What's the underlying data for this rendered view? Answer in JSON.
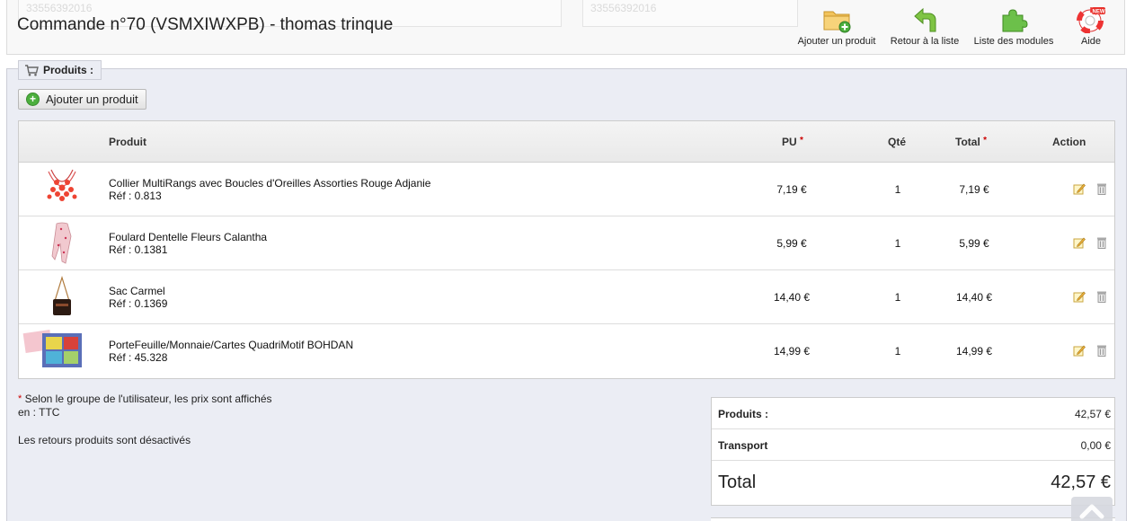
{
  "header": {
    "ghost_field_a": "33556392016",
    "ghost_field_b": "33556392016",
    "title": "Commande n°70 (VSMXIWXPB) - thomas trinque",
    "toolbar": {
      "add_product": "Ajouter un produit",
      "back_to_list": "Retour à la liste",
      "modules_list": "Liste des modules",
      "help": "Aide",
      "help_badge": "NEW"
    }
  },
  "panel": {
    "legend": "Produits :",
    "add_button": "Ajouter un produit"
  },
  "table": {
    "headers": {
      "product": "Produit",
      "unit_price": "PU",
      "unit_price_mark": "*",
      "qty": "Qté",
      "total": "Total",
      "total_mark": "*",
      "action": "Action"
    },
    "rows": [
      {
        "name": "Collier MultiRangs avec Boucles d'Oreilles Assorties Rouge Adjanie",
        "ref": "Réf : 0.813",
        "pu": "7,19 €",
        "qty": "1",
        "total": "7,19 €"
      },
      {
        "name": "Foulard Dentelle Fleurs Calantha",
        "ref": "Réf : 0.1381",
        "pu": "5,99 €",
        "qty": "1",
        "total": "5,99 €"
      },
      {
        "name": "Sac Carmel",
        "ref": "Réf : 0.1369",
        "pu": "14,40 €",
        "qty": "1",
        "total": "14,40 €"
      },
      {
        "name": "PorteFeuille/Monnaie/Cartes QuadriMotif BOHDAN",
        "ref": "Réf : 45.328",
        "pu": "14,99 €",
        "qty": "1",
        "total": "14,99 €"
      }
    ]
  },
  "notes": {
    "asterisk": "*",
    "price_group": "Selon le groupe de l'utilisateur, les prix sont affichés en : TTC",
    "returns": "Les retours produits sont désactivés"
  },
  "totals": {
    "products_label": "Produits :",
    "products_value": "42,57 €",
    "shipping_label": "Transport",
    "shipping_value": "0,00 €",
    "total_label": "Total",
    "total_value": "42,57 €"
  },
  "colors": {
    "panel_bg": "#ebedf4",
    "required_mark": "#cc0000",
    "add_green": "#4caf3d"
  }
}
